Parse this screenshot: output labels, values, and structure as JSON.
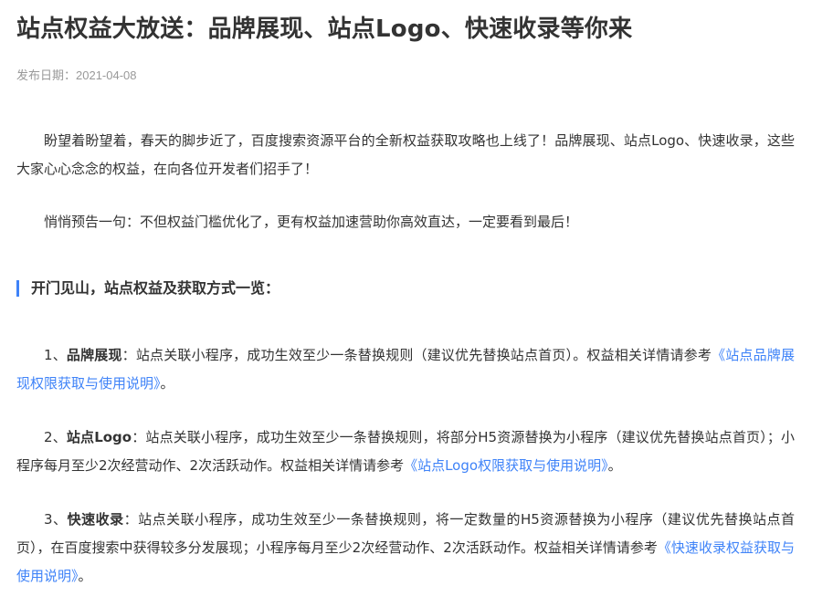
{
  "article": {
    "title": "站点权益大放送：品牌展现、站点Logo、快速收录等你来",
    "publish_label": "发布日期：",
    "publish_date": "2021-04-08",
    "intro": "盼望着盼望着，春天的脚步近了，百度搜索资源平台的全新权益获取攻略也上线了！品牌展现、站点Logo、快速收录，这些大家心心念念的权益，在向各位开发者们招手了！",
    "teaser": "悄悄预告一句：不但权益门槛优化了，更有权益加速营助你高效直达，一定要看到最后！",
    "section_heading": "开门见山，站点权益及获取方式一览：",
    "items": [
      {
        "prefix": "1、",
        "name": "品牌展现",
        "body": "：站点关联小程序，成功生效至少一条替换规则（建议优先替换站点首页）。权益相关详情请参考",
        "link": "《站点品牌展现权限获取与使用说明》",
        "suffix": "。"
      },
      {
        "prefix": "2、",
        "name": "站点Logo",
        "body": "：站点关联小程序，成功生效至少一条替换规则，将部分H5资源替换为小程序（建议优先替换站点首页）；小程序每月至少2次经营动作、2次活跃动作。权益相关详情请参考",
        "link": "《站点Logo权限获取与使用说明》",
        "suffix": "。"
      },
      {
        "prefix": "3、",
        "name": "快速收录",
        "body": "：站点关联小程序，成功生效至少一条替换规则，将一定数量的H5资源替换为小程序（建议优先替换站点首页），在百度搜索中获得较多分发展现；小程序每月至少2次经营动作、2次活跃动作。权益相关详情请参考",
        "link": "《快速收录权益获取与使用说明》",
        "suffix": "。"
      }
    ]
  },
  "colors": {
    "text": "#333333",
    "meta": "#999999",
    "link": "#3f83f8",
    "accent_bar": "#3f83f8"
  }
}
